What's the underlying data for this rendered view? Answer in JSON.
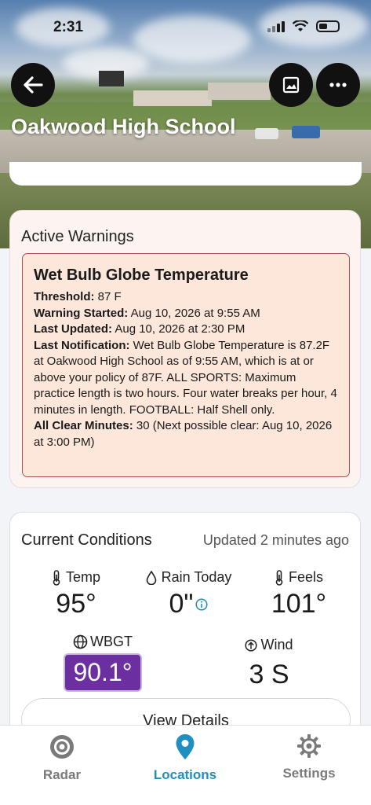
{
  "status_bar": {
    "time": "2:31"
  },
  "location": {
    "title": "Oakwood High School"
  },
  "warnings": {
    "header": "Active Warnings",
    "item": {
      "title": "Wet Bulb Globe Temperature",
      "threshold_label": "Threshold:",
      "threshold_value": "87 F",
      "started_label": "Warning Started:",
      "started_value": "Aug 10, 2026 at 9:55 AM",
      "updated_label": "Last Updated:",
      "updated_value": "Aug 10, 2026 at 2:30 PM",
      "notification_label": "Last Notification:",
      "notification_value": "Wet Bulb Globe Temperature is 87.2F at Oakwood High School  as of 9:55 AM, which is at or above your policy of 87F. ALL SPORTS: Maximum practice length is two hours. Four water breaks per hour, 4 minutes in length. FOOTBALL: Half Shell only.",
      "allclear_label": "All Clear Minutes:",
      "allclear_value": "30 (Next possible clear: Aug 10, 2026 at 3:00 PM)"
    }
  },
  "conditions": {
    "header": "Current Conditions",
    "updated": "Updated 2 minutes ago",
    "temp": {
      "label": "Temp",
      "value": "95°"
    },
    "rain": {
      "label": "Rain Today",
      "value": "0\""
    },
    "feels": {
      "label": "Feels",
      "value": "101°"
    },
    "wbgt": {
      "label": "WBGT",
      "value": "90.1°",
      "color": "#6b2fa0"
    },
    "wind": {
      "label": "Wind",
      "value": "3 S"
    },
    "details_button": "View Details"
  },
  "tabs": [
    {
      "label": "Radar",
      "icon": "radar-icon",
      "active": false
    },
    {
      "label": "Locations",
      "icon": "location-pin-icon",
      "active": true
    },
    {
      "label": "Settings",
      "icon": "gear-icon",
      "active": false
    }
  ],
  "colors": {
    "accent": "#1f8fc2",
    "inactive": "#7a7a7a",
    "warning_border": "#a8504c"
  }
}
